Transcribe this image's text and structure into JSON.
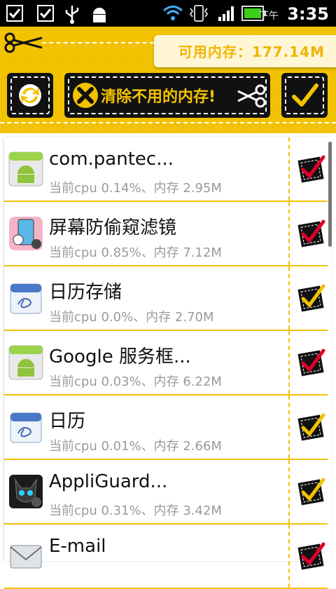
{
  "status_bar": {
    "ampm": "下午",
    "time": "3:35",
    "icons": [
      "checkbox-notification-icon",
      "checkbox-notification-icon",
      "usb-icon",
      "android-debug-icon",
      "wifi-icon",
      "vibrate-icon",
      "signal-icon",
      "battery-icon"
    ]
  },
  "header": {
    "available_memory": "可用内存：177.14M",
    "clean_button_label": "清除不用的内存!",
    "icons": {
      "refresh": "refresh-icon",
      "clean": "close-x-icon",
      "scissors": "scissors-icon",
      "select_all": "checkmark-icon"
    }
  },
  "colors": {
    "accent": "#f2c200",
    "check_red": "#e0002a",
    "check_yellow": "#f2c200",
    "dark": "#111111"
  },
  "apps": [
    {
      "name": "com.pantec...",
      "stats": "当前cpu    0.14%、内存 2.95M",
      "icon": "android-app-icon",
      "checked_style": "red"
    },
    {
      "name": "屏幕防偷窥滤镜",
      "stats": "当前cpu    0.85%、内存 7.12M",
      "icon": "privacy-filter-icon",
      "checked_style": "red"
    },
    {
      "name": "日历存储",
      "stats": "当前cpu    0.0%、内存 2.70M",
      "icon": "calendar-icon",
      "checked_style": "yellow"
    },
    {
      "name": "Google 服务框...",
      "stats": "当前cpu    0.03%、内存 6.22M",
      "icon": "android-app-icon",
      "checked_style": "red"
    },
    {
      "name": "日历",
      "stats": "当前cpu    0.01%、内存 2.66M",
      "icon": "calendar-icon",
      "checked_style": "yellow"
    },
    {
      "name": "AppliGuard...",
      "stats": "当前cpu    0.31%、内存 3.42M",
      "icon": "appliguard-icon",
      "checked_style": "yellow"
    },
    {
      "name": "E-mail",
      "stats": "",
      "icon": "email-icon",
      "checked_style": "red"
    }
  ]
}
